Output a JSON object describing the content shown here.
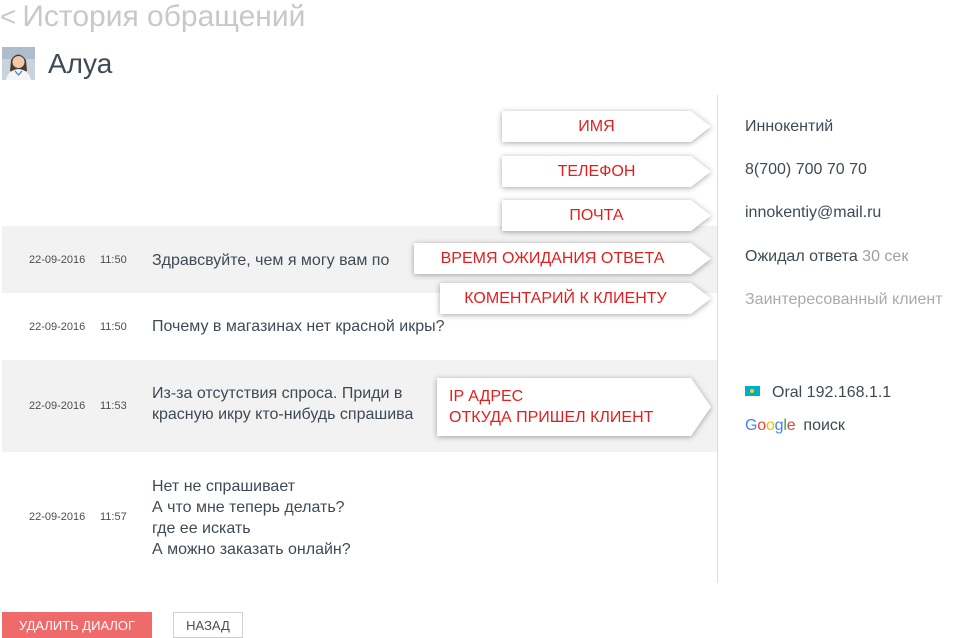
{
  "header": {
    "back_chevron": "<",
    "title": "История обращений"
  },
  "user": {
    "name": "Алуа"
  },
  "messages": [
    {
      "date": "22-09-2016",
      "time": "11:50",
      "lines": [
        "Здравсвуйте, чем я могу вам по"
      ]
    },
    {
      "date": "22-09-2016",
      "time": "11:50",
      "lines": [
        "Почему в магазинах нет красной икры?"
      ]
    },
    {
      "date": "22-09-2016",
      "time": "11:53",
      "lines": [
        "Из-за отсутствия спроса. Приди в",
        "красную икру кто-нибудь спрашива"
      ]
    },
    {
      "date": "22-09-2016",
      "time": "11:57",
      "lines": [
        "Нет не спрашивает",
        "А что мне теперь делать?",
        "где ее искать",
        "А можно заказать онлайн?"
      ]
    }
  ],
  "annotations": {
    "name": "ИМЯ",
    "phone": "ТЕЛЕФОН",
    "email": "ПОЧТА",
    "wait_time": "ВРЕМЯ ОЖИДАНИЯ ОТВЕТА",
    "comment": "КОМЕНТАРИЙ К КЛИЕНТУ",
    "ip_line1": "IP АДРЕС",
    "ip_line2": "ОТКУДА ПРИШЕЛ КЛИЕНТ"
  },
  "client_info": {
    "name": "Иннокентий",
    "phone": "8(700) 700 70 70",
    "email": "innokentiy@mail.ru",
    "wait_label": "Ожидал ответа",
    "wait_value": "30 сек",
    "comment": "Заинтересованный клиент",
    "location": "Oral 192.168.1.1",
    "source_brand": "Google",
    "source_text": "поиск"
  },
  "buttons": {
    "delete": "УДАЛИТЬ ДИАЛОГ",
    "back": "НАЗАД"
  },
  "colors": {
    "accent_red": "#e41e1e",
    "delete_button": "#ef6b6b",
    "shaded_row": "#f2f2f2",
    "kz_flag": "#00aec7"
  }
}
